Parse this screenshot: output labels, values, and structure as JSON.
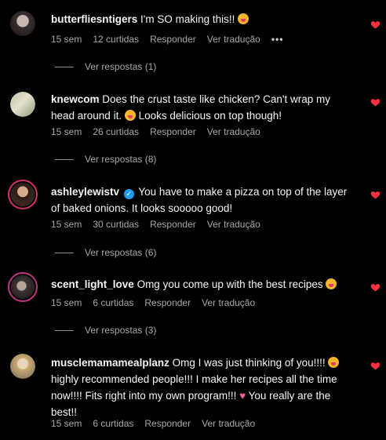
{
  "colors": {
    "background": "#000000",
    "text": "#f5f5f5",
    "muted": "#a8a8a8",
    "heart": "#ff3040",
    "verified": "#1d9bf0"
  },
  "comments": [
    {
      "username": "butterfliesntigers",
      "text": "I'm SO making this!!",
      "time": "15 sem",
      "likes": "12 curtidas",
      "reply_label": "Responder",
      "translate_label": "Ver tradução",
      "more_label": "•••",
      "view_replies": "Ver respostas (1)"
    },
    {
      "username": "knewcom",
      "text": "Does the crust taste like chicken? Can't wrap my head around it.",
      "text_after_emoji": "Looks delicious on top though!",
      "time": "15 sem",
      "likes": "26 curtidas",
      "reply_label": "Responder",
      "translate_label": "Ver tradução",
      "view_replies": "Ver respostas (8)"
    },
    {
      "username": "ashleylewistv",
      "verified": true,
      "text": "You have to make a pizza on top of the layer of baked onions. It looks sooooo good!",
      "time": "15 sem",
      "likes": "30 curtidas",
      "reply_label": "Responder",
      "translate_label": "Ver tradução",
      "view_replies": "Ver respostas (6)"
    },
    {
      "username": "scent_light_love",
      "text": "Omg you come up with the best recipes",
      "time": "15 sem",
      "likes": "6 curtidas",
      "reply_label": "Responder",
      "translate_label": "Ver tradução",
      "view_replies": "Ver respostas (3)"
    },
    {
      "username": "musclemamamealplanz",
      "text": "Omg I was just thinking of you!!!!",
      "text_after_emoji": "highly recommended people!!! I make her recipes all the time now!!!! Fits right into my own program!!!",
      "text_after_heart": "You really are the best!!",
      "time": "15 sem",
      "likes": "6 curtidas",
      "reply_label": "Responder",
      "translate_label": "Ver tradução"
    }
  ]
}
